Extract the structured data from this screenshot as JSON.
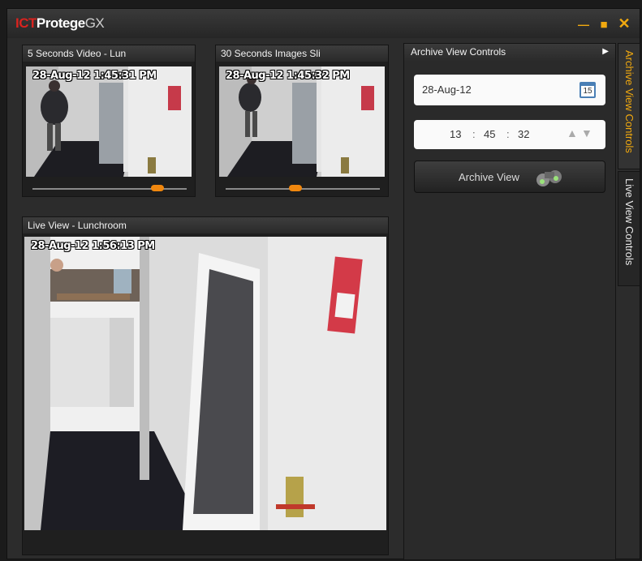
{
  "app": {
    "logo_ict": "ICT",
    "logo_protege": "Protege",
    "logo_gx": "GX"
  },
  "window_controls": {
    "minimize": "—",
    "maximize": "■",
    "close": "✕"
  },
  "cameras": {
    "cam1": {
      "title": "5 Seconds Video - Lun",
      "timestamp": "28-Aug-12 1:45:31 PM",
      "playback_position": 0.81
    },
    "cam2": {
      "title": "30 Seconds Images Sli",
      "timestamp": "28-Aug-12 1:45:32 PM",
      "playback_position": 0.45
    },
    "live": {
      "title": "Live View - Lunchroom",
      "timestamp": "28-Aug-12 1:56:13 PM"
    }
  },
  "archive_controls": {
    "title": "Archive View Controls",
    "date_value": "28-Aug-12",
    "calendar_day": "15",
    "time_h": "13",
    "time_m": "45",
    "time_s": "32",
    "time_sep": ":",
    "button_label": "Archive View"
  },
  "side_tabs": {
    "archive": "Archive View Controls",
    "live": "Live View Controls"
  },
  "colors": {
    "accent": "#f1a90f",
    "brand_red": "#d9231f",
    "slider": "#f0870e"
  }
}
